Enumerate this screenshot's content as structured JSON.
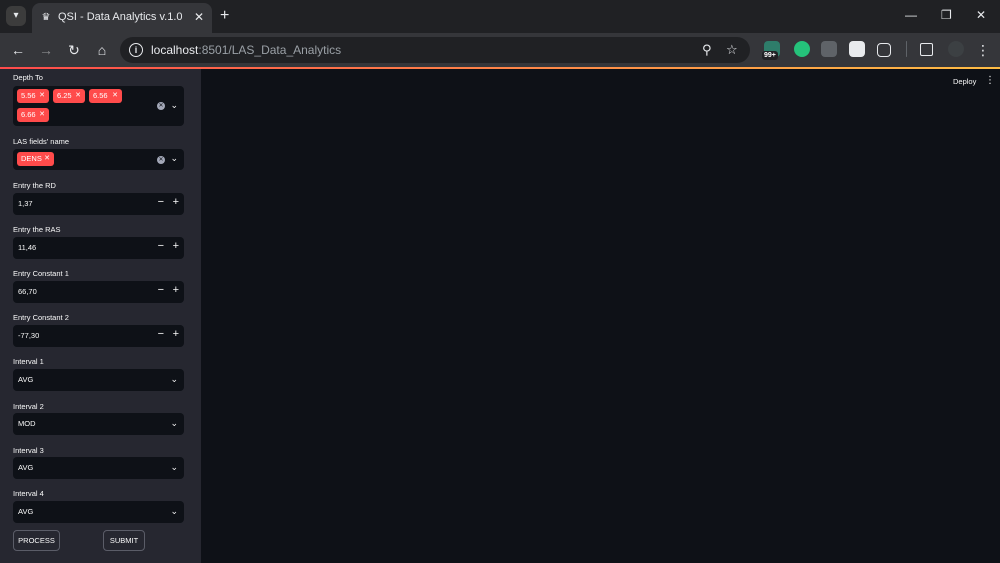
{
  "browser": {
    "tab_title": "QSI - Data Analytics v.1.0",
    "url_host": "localhost",
    "url_path": ":8501/LAS_Data_Analytics",
    "extension_badge": "99+",
    "icons": {
      "tab_list": "chevron-down-icon",
      "favicon": "crown-icon",
      "close": "close-icon",
      "new_tab": "plus-icon",
      "back": "arrow-left-icon",
      "forward": "arrow-right-icon",
      "reload": "reload-icon",
      "home": "home-icon",
      "site_info": "info-icon",
      "zoom": "zoom-icon",
      "bookmark": "star-icon"
    }
  },
  "app": {
    "deploy_label": "Deploy",
    "accent_color": "#ff4b4b"
  },
  "sidebar": {
    "depth_to": {
      "label": "Depth To",
      "tags": [
        "5.56",
        "6.25",
        "6.56",
        "6.66"
      ]
    },
    "las_fields": {
      "label": "LAS fields' name",
      "tags": [
        "DENS"
      ]
    },
    "rd": {
      "label": "Entry the RD",
      "value": "1,37"
    },
    "ras": {
      "label": "Entry the RAS",
      "value": "11,46"
    },
    "constant1": {
      "label": "Entry Constant 1",
      "value": "66,70"
    },
    "constant2": {
      "label": "Entry Constant 2",
      "value": "-77,30"
    },
    "interval1": {
      "label": "Interval 1",
      "value": "AVG"
    },
    "interval2": {
      "label": "Interval 2",
      "value": "MOD"
    },
    "interval3": {
      "label": "Interval 3",
      "value": "AVG"
    },
    "interval4": {
      "label": "Interval 4",
      "value": "AVG"
    },
    "process_label": "PROCESS",
    "submit_label": "SUBMIT"
  }
}
